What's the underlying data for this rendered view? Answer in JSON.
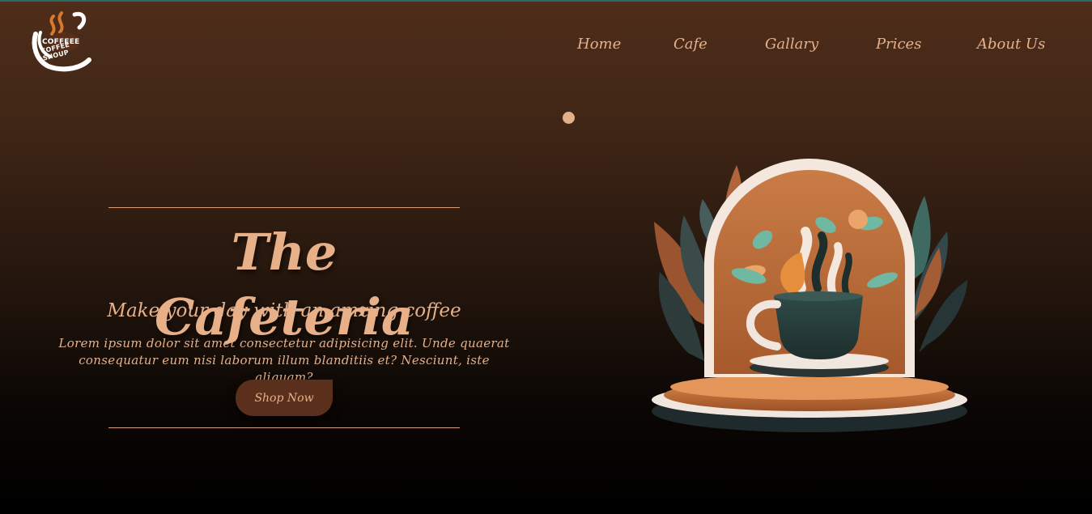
{
  "brand": {
    "logo_line1": "COFFEEE",
    "logo_line2": "COFFEE SHOUP",
    "icon": "coffee-cup-logo-icon"
  },
  "nav": {
    "items": [
      {
        "label": "Home"
      },
      {
        "label": "Cafe"
      },
      {
        "label": "Gallary"
      },
      {
        "label": "Prices"
      },
      {
        "label": "About Us"
      }
    ]
  },
  "hero": {
    "title": "The Cafeteria",
    "subtitle": "Make your day with an amzing coffee",
    "body": "Lorem ipsum dolor sit amet consectetur adipisicing elit. Unde quaerat consequatur eum nisi laborum illum blanditiis et? Nesciunt, iste aliquam?",
    "cta_label": "Shop Now"
  },
  "illustration": {
    "icon": "coffee-cup-illustration"
  },
  "colors": {
    "accent": "#e7b088",
    "button_bg": "#5a2f1c",
    "bg_top": "#4f2d1a",
    "bg_bottom": "#000000"
  }
}
